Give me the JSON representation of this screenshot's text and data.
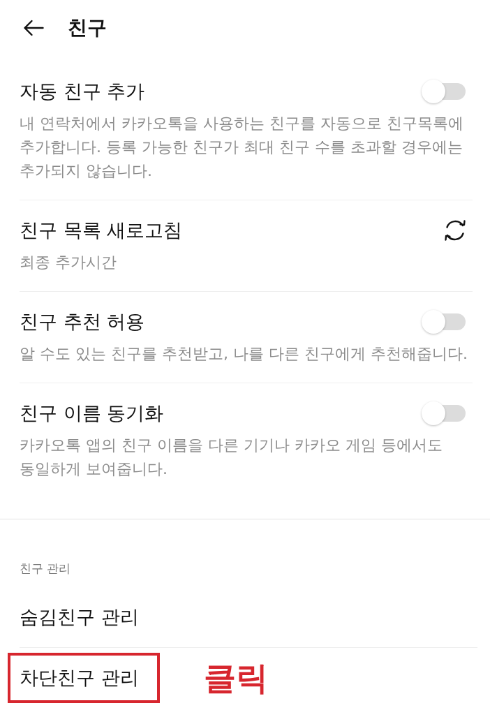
{
  "header": {
    "title": "친구"
  },
  "settings": [
    {
      "kind": "toggle",
      "title": "자동 친구 추가",
      "description": "내 연락처에서 카카오톡을 사용하는 친구를 자동으로 친구목록에 추가합니다. 등록 가능한 친구가 최대 친구 수를 초과할 경우에는 추가되지 않습니다.",
      "on": false
    },
    {
      "kind": "refresh",
      "title": "친구 목록 새로고침",
      "description": "최종 추가시간"
    },
    {
      "kind": "toggle",
      "title": "친구 추천 허용",
      "description": "알 수도 있는 친구를 추천받고, 나를 다른 친구에게 추천해줍니다.",
      "on": false
    },
    {
      "kind": "toggle",
      "title": "친구 이름 동기화",
      "description": "카카오톡 앱의 친구 이름을 다른 기기나 카카오 게임 등에서도 동일하게 보여줍니다.",
      "on": false
    }
  ],
  "section": {
    "title": "친구 관리",
    "items": [
      {
        "label": "숨김친구 관리",
        "highlighted": false
      },
      {
        "label": "차단친구 관리",
        "highlighted": true
      }
    ]
  },
  "annotation": {
    "text": "클릭"
  }
}
